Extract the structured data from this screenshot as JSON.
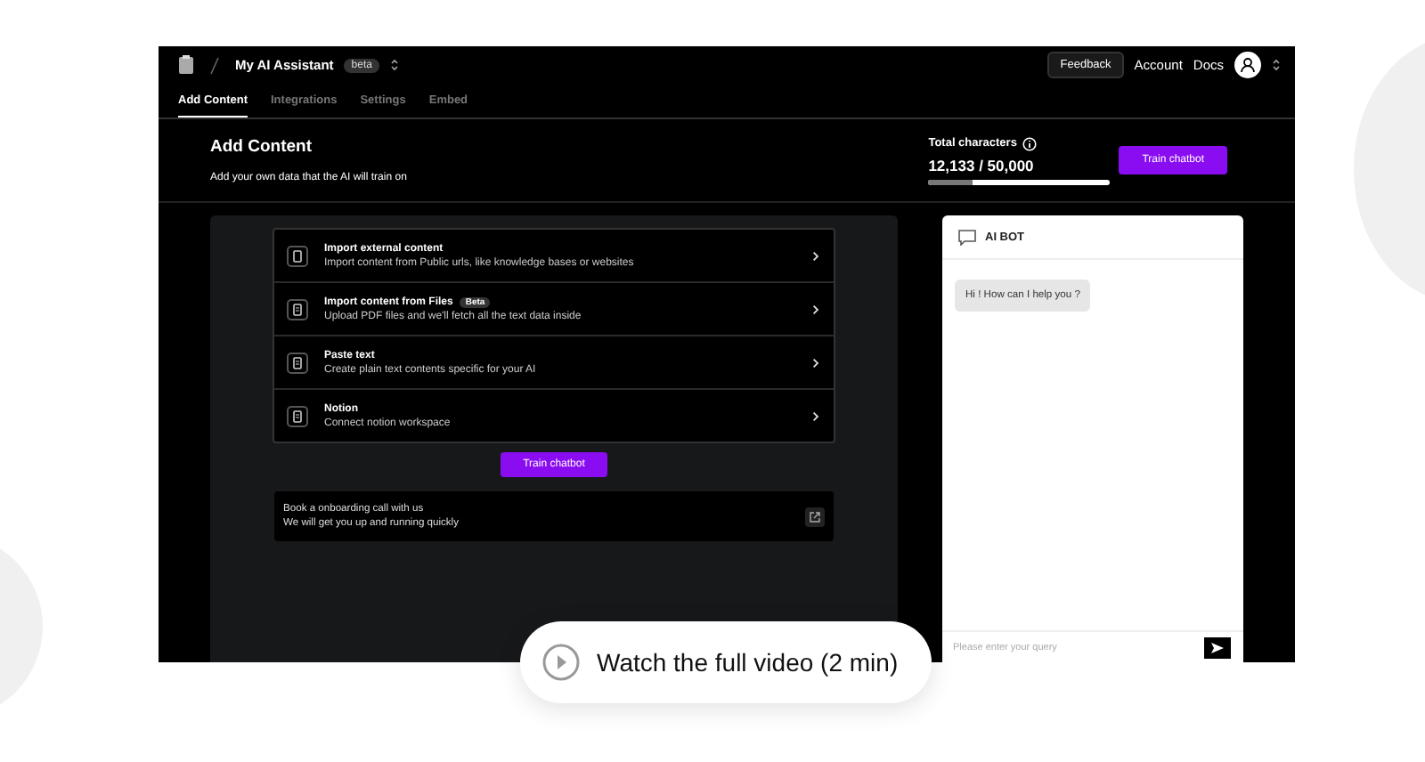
{
  "topbar": {
    "app_name": "My AI Assistant",
    "badge": "beta",
    "feedback": "Feedback",
    "links": [
      "Account",
      "Docs"
    ]
  },
  "tabs": [
    {
      "label": "Add Content",
      "selected": true
    },
    {
      "label": "Integrations",
      "selected": false
    },
    {
      "label": "Settings",
      "selected": false
    },
    {
      "label": "Embed",
      "selected": false
    }
  ],
  "header": {
    "title": "Add Content",
    "subtitle": "Add your own data that the AI will train on",
    "total_label": "Total characters",
    "total_value": "12,133 / 50,000",
    "level": 0.24,
    "button": "Train chatbot"
  },
  "sources": [
    {
      "title": "Import external content",
      "description": "Import content from Public urls, like knowledge bases or websites"
    },
    {
      "title": "Import content from Files",
      "badge": "Beta",
      "description": "Upload PDF files and we'll fetch all the text data inside"
    },
    {
      "title": "Paste text",
      "description": "Create plain text contents specific for your AI"
    },
    {
      "title": "Notion",
      "description": "Connect notion workspace"
    }
  ],
  "train_button": "Train chatbot",
  "onboarding": {
    "title": "Book a onboarding call with us",
    "subtitle": "We will get you up and running quickly"
  },
  "chat": {
    "title": "AI BOT",
    "messages": [
      "Hi ! How can I help you ?"
    ],
    "placeholder": "Please enter your query"
  },
  "video_button": "Watch the full video (2 min)"
}
